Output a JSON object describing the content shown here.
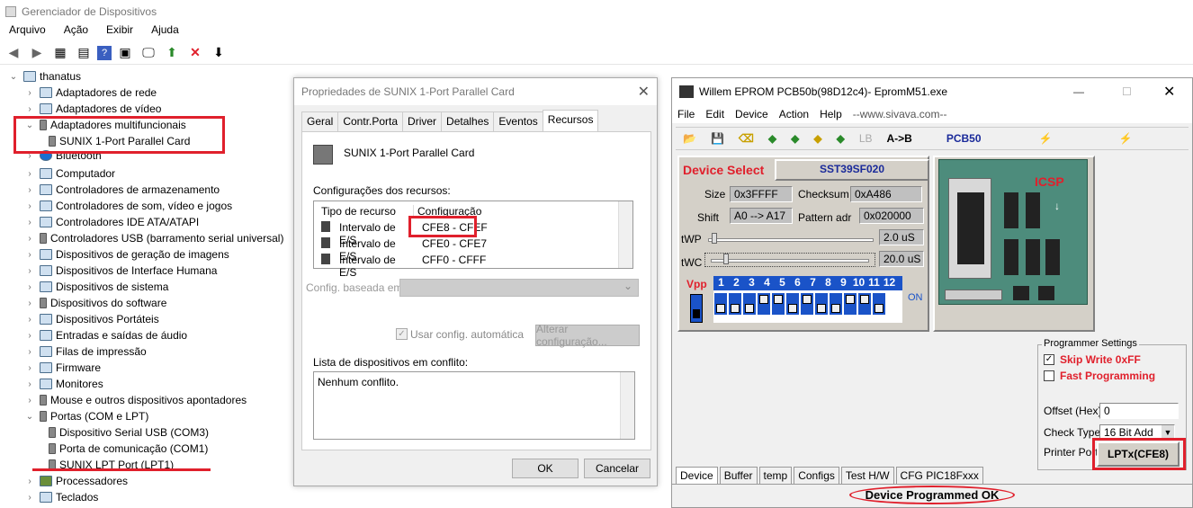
{
  "device_manager": {
    "title": "Gerenciador de Dispositivos",
    "menu": [
      "Arquivo",
      "Ação",
      "Exibir",
      "Ajuda"
    ],
    "root": "thanatus",
    "items": [
      {
        "label": "Adaptadores de rede"
      },
      {
        "label": "Adaptadores de vídeo"
      },
      {
        "label": "Adaptadores multifuncionais"
      },
      {
        "label": "SUNIX 1-Port Parallel Card"
      },
      {
        "label": "Bluetooth"
      },
      {
        "label": "Computador"
      },
      {
        "label": "Controladores de armazenamento"
      },
      {
        "label": "Controladores de som, vídeo e jogos"
      },
      {
        "label": "Controladores IDE ATA/ATAPI"
      },
      {
        "label": "Controladores USB (barramento serial universal)"
      },
      {
        "label": "Dispositivos de geração de imagens"
      },
      {
        "label": "Dispositivos de Interface Humana"
      },
      {
        "label": "Dispositivos de sistema"
      },
      {
        "label": "Dispositivos do software"
      },
      {
        "label": "Dispositivos Portáteis"
      },
      {
        "label": "Entradas e saídas de áudio"
      },
      {
        "label": "Filas de impressão"
      },
      {
        "label": "Firmware"
      },
      {
        "label": "Monitores"
      },
      {
        "label": "Mouse e outros dispositivos apontadores"
      },
      {
        "label": "Portas (COM e LPT)"
      },
      {
        "label": "Dispositivo Serial USB (COM3)"
      },
      {
        "label": "Porta de comunicação (COM1)"
      },
      {
        "label": "SUNIX LPT Port (LPT1)"
      },
      {
        "label": "Processadores"
      },
      {
        "label": "Teclados"
      }
    ]
  },
  "dialog": {
    "title": "Propriedades de SUNIX 1-Port Parallel Card",
    "tabs": [
      "Geral",
      "Contr.Porta",
      "Driver",
      "Detalhes",
      "Eventos",
      "Recursos"
    ],
    "device_name": "SUNIX 1-Port Parallel Card",
    "resources_label": "Configurações dos recursos:",
    "col_type": "Tipo de recurso",
    "col_config": "Configuração",
    "rows": [
      {
        "type": "Intervalo de E/S",
        "config": "CFE8 - CFEF"
      },
      {
        "type": "Intervalo de E/S",
        "config": "CFE0 - CFE7"
      },
      {
        "type": "Intervalo de E/S",
        "config": "CFF0 - CFFF"
      }
    ],
    "config_based_label": "Config. baseada em:",
    "auto_config_label": "Usar config. automática",
    "change_config_button": "Alterar configuração...",
    "conflict_label": "Lista de dispositivos em conflito:",
    "conflict_text": "Nenhum conflito.",
    "ok": "OK",
    "cancel": "Cancelar"
  },
  "willem": {
    "title": "Willem EPROM PCB50b(98D12c4)- EpromM51.exe",
    "menu": [
      "File",
      "Edit",
      "Device",
      "Action",
      "Help"
    ],
    "website": "--www.sivava.com--",
    "toolbar_ab": "A->B",
    "toolbar_pcb": "PCB50",
    "toolbar_lb": "LB",
    "device_select_label": "Device Select",
    "device": "SST39SF020",
    "size_label": "Size",
    "size": "0x3FFFF",
    "checksum_label": "Checksum",
    "checksum": "0xA486",
    "shift_label": "Shift",
    "shift": "A0 --> A17",
    "pattern_label": "Pattern adr",
    "pattern": "0x020000",
    "twp_label": "tWP",
    "twp": "2.0 uS",
    "twc_label": "tWC",
    "twc": "20.0 uS",
    "vpp_label": "Vpp",
    "dip_numbers": [
      "1",
      "2",
      "3",
      "4",
      "5",
      "6",
      "7",
      "8",
      "9",
      "10",
      "11",
      "12"
    ],
    "on_label": "ON",
    "icsp_label": "ICSP",
    "programmer_settings": "Programmer Settings",
    "skip_write": "Skip Write 0xFF",
    "fast_programming": "Fast Programming",
    "offset_label": "Offset (Hex)",
    "offset": "0",
    "check_type_label": "Check Type",
    "check_type": "16 Bit Add",
    "printer_port_label": "Printer Port",
    "printer_port": "LPTx(CFE8)",
    "tabs": [
      "Device",
      "Buffer",
      "temp",
      "Configs",
      "Test H/W",
      "CFG PIC18Fxxx"
    ],
    "status": "Device Programmed OK"
  }
}
